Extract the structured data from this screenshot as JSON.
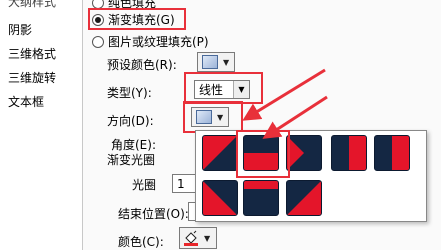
{
  "sidebar": {
    "items": [
      {
        "label": "大纲样式"
      },
      {
        "label": "阴影"
      },
      {
        "label": "三维格式"
      },
      {
        "label": "三维旋转"
      },
      {
        "label": "文本框"
      }
    ]
  },
  "fill": {
    "solid_partial": "纯色填充",
    "gradient": "渐变填充(G)",
    "picture": "图片或纹理填充(P)"
  },
  "preset_colors": {
    "label": "预设颜色(R):"
  },
  "type": {
    "label": "类型(Y):",
    "value": "线性"
  },
  "direction": {
    "label": "方向(D):"
  },
  "angle": {
    "label": "角度(E):"
  },
  "gradient_stops": {
    "label": "渐变光圈"
  },
  "stop": {
    "label": "光圈 1",
    "value": "1"
  },
  "end_position": {
    "label": "结束位置(O):"
  },
  "color": {
    "label": "颜色(C):"
  },
  "colors": {
    "highlight_red": "#e8303a",
    "tile_dark": "#142743",
    "tile_red": "#e4152a",
    "swatch_red": "#e8262a"
  }
}
